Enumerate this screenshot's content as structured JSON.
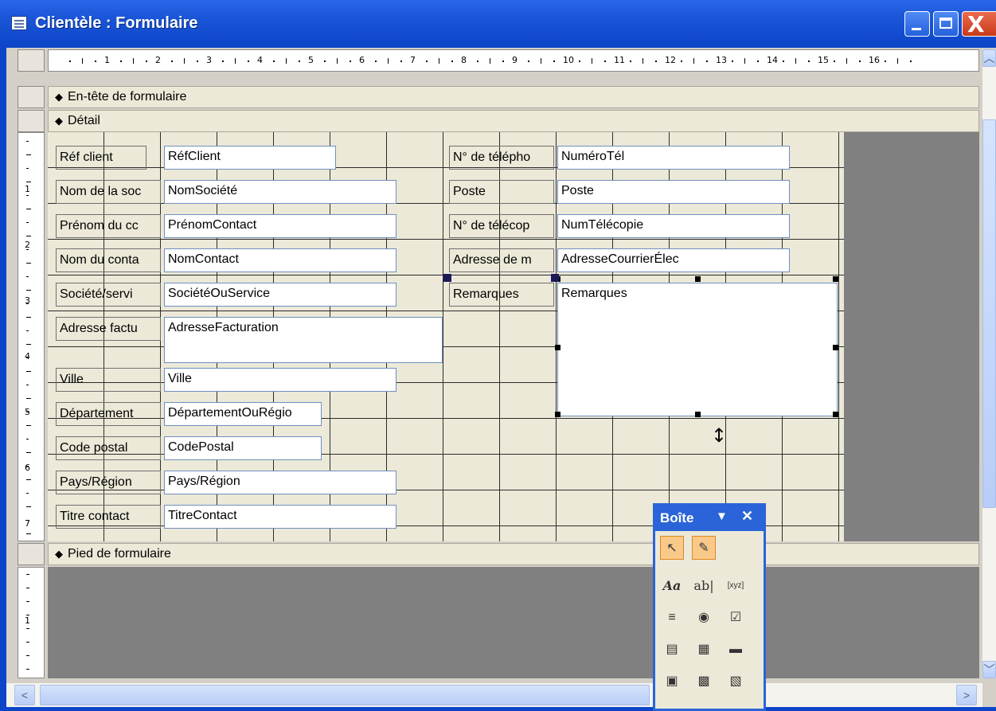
{
  "window": {
    "title": "Clientèle : Formulaire",
    "close_glyph": "X"
  },
  "ruler": {
    "h_numbers": [
      "1",
      "2",
      "3",
      "4",
      "5",
      "6",
      "7",
      "8",
      "9",
      "10",
      "11",
      "12",
      "13",
      "14",
      "15",
      "16"
    ],
    "v_numbers_detail": [
      "1",
      "2",
      "3",
      "4",
      "5",
      "6",
      "7"
    ],
    "v_numbers_footer": [
      "1"
    ]
  },
  "sections": {
    "header": "En-tête de formulaire",
    "detail": "Détail",
    "footer": "Pied de formulaire"
  },
  "controls": {
    "labels": [
      "Réf client",
      "Nom de la soc",
      "Prénom du cc",
      "Nom du conta",
      "Société/servi",
      "Adresse factu",
      "Ville",
      "Département",
      "Code postal",
      "Pays/Région",
      "Titre contact",
      "N° de télépho",
      "Poste",
      "N° de télécop",
      "Adresse de m",
      "Remarques"
    ],
    "fields": [
      "RéfClient",
      "NomSociété",
      "PrénomContact",
      "NomContact",
      "SociétéOuService",
      "AdresseFacturation",
      "Ville",
      "DépartementOuRégio",
      "CodePostal",
      "Pays/Région",
      "TitreContact",
      "NuméroTél",
      "Poste",
      "NumTélécopie",
      "AdresseCourrierÉlec",
      "Remarques"
    ]
  },
  "toolbox": {
    "title": "Boîte",
    "tools": [
      "select-pointer",
      "control-wizards",
      "label",
      "text-box",
      "option-group",
      "toggle-button",
      "option-button",
      "check-box",
      "combo-box",
      "list-box",
      "command-button",
      "image",
      "unbound-object-frame",
      "bound-object-frame"
    ]
  },
  "cursor": "↕"
}
